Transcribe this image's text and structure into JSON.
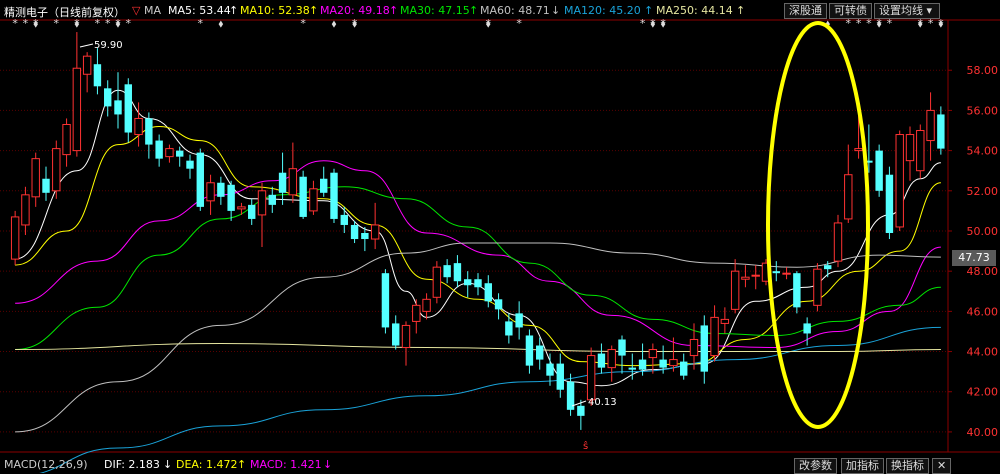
{
  "header": {
    "stock_name": "精测电子（日线前复权）",
    "ma_label": "MA",
    "ma5": "MA5: 53.44",
    "ma10": "MA10: 52.38",
    "ma20": "MA20: 49.18",
    "ma30": "MA30: 47.15",
    "ma60": "MA60: 48.71",
    "ma120": "MA120: 45.20",
    "ma250": "MA250: 44.14",
    "arrow_up": "↑",
    "arrow_down": "↓",
    "btn_shengutong": "深股通",
    "btn_kezhuanzhai": "可转债",
    "btn_setma": "设置均线"
  },
  "footer": {
    "macd_title": "MACD(12,26,9)",
    "dif": "DIF: 2.183",
    "dea": "DEA: 1.472",
    "macd": "MACD: 1.421",
    "btn_params": "改参数",
    "btn_add": "加指标",
    "btn_switch": "换指标"
  },
  "colors": {
    "up": "#ff3232",
    "down": "#54ffff",
    "ma5": "#ffffff",
    "ma10": "#ffff00",
    "ma20": "#ff00ff",
    "ma30": "#00e600",
    "ma60": "#c0c0c0",
    "ma120": "#1aa3d9",
    "ma250": "#e6e6a0",
    "ellipse": "#ffff00"
  },
  "chart_data": {
    "type": "candlestick",
    "y_ticks": [
      "58.00",
      "56.00",
      "54.00",
      "52.00",
      "50.00",
      "48.00",
      "46.00",
      "44.00",
      "42.00",
      "40.00"
    ],
    "current_price": "47.73",
    "high_annotation": "59.90",
    "low_annotation": "40.13",
    "ylim": [
      39.2,
      60.5
    ],
    "candles": [
      [
        48.6,
        50.7,
        48.3,
        51.0
      ],
      [
        50.3,
        51.8,
        49.8,
        52.2
      ],
      [
        51.7,
        53.6,
        51.2,
        53.9
      ],
      [
        52.6,
        51.9,
        51.5,
        53.2
      ],
      [
        52.0,
        54.1,
        51.6,
        54.5
      ],
      [
        53.8,
        55.3,
        53.2,
        55.6
      ],
      [
        54.0,
        58.1,
        53.7,
        59.9
      ],
      [
        57.8,
        58.7,
        56.9,
        58.9
      ],
      [
        58.3,
        57.2,
        56.8,
        59.1
      ],
      [
        57.1,
        56.2,
        55.7,
        57.5
      ],
      [
        56.5,
        55.8,
        55.1,
        57.9
      ],
      [
        57.3,
        54.9,
        54.4,
        57.6
      ],
      [
        54.8,
        55.6,
        54.2,
        56.4
      ],
      [
        55.6,
        54.3,
        53.6,
        55.9
      ],
      [
        54.5,
        53.6,
        53.2,
        54.8
      ],
      [
        53.7,
        54.1,
        53.4,
        54.3
      ],
      [
        54.0,
        53.7,
        53.2,
        54.2
      ],
      [
        53.5,
        53.1,
        52.6,
        53.8
      ],
      [
        53.9,
        51.2,
        51.0,
        54.1
      ],
      [
        51.5,
        52.4,
        50.8,
        52.8
      ],
      [
        52.4,
        51.7,
        51.3,
        52.7
      ],
      [
        52.3,
        51.0,
        50.5,
        52.5
      ],
      [
        51.1,
        51.2,
        50.8,
        51.4
      ],
      [
        51.3,
        50.6,
        50.3,
        51.6
      ],
      [
        50.8,
        52.0,
        49.2,
        52.4
      ],
      [
        51.8,
        51.3,
        50.9,
        52.2
      ],
      [
        52.9,
        51.9,
        51.3,
        53.9
      ],
      [
        51.8,
        53.1,
        51.4,
        54.4
      ],
      [
        52.7,
        50.7,
        50.6,
        53.0
      ],
      [
        51.0,
        52.1,
        50.8,
        52.5
      ],
      [
        52.6,
        51.9,
        51.7,
        53.2
      ],
      [
        52.9,
        50.6,
        50.4,
        53.1
      ],
      [
        50.8,
        50.3,
        49.9,
        51.2
      ],
      [
        50.3,
        49.6,
        49.4,
        50.5
      ],
      [
        49.9,
        49.6,
        49.0,
        50.2
      ],
      [
        49.6,
        50.3,
        49.1,
        51.4
      ],
      [
        47.9,
        45.2,
        44.9,
        48.1
      ],
      [
        45.4,
        44.3,
        44.1,
        45.8
      ],
      [
        44.2,
        45.3,
        43.3,
        45.5
      ],
      [
        45.5,
        46.3,
        44.9,
        46.6
      ],
      [
        46.0,
        46.6,
        45.6,
        46.9
      ],
      [
        46.7,
        48.2,
        46.4,
        48.5
      ],
      [
        48.3,
        47.7,
        47.4,
        48.6
      ],
      [
        48.4,
        47.5,
        47.2,
        48.8
      ],
      [
        47.6,
        47.3,
        46.7,
        48.0
      ],
      [
        47.6,
        47.2,
        46.8,
        47.9
      ],
      [
        47.4,
        46.5,
        46.2,
        47.8
      ],
      [
        46.6,
        46.1,
        45.6,
        46.9
      ],
      [
        45.5,
        44.8,
        44.4,
        45.9
      ],
      [
        45.9,
        45.2,
        44.6,
        46.5
      ],
      [
        44.8,
        43.3,
        42.9,
        45.1
      ],
      [
        44.3,
        43.6,
        43.1,
        44.7
      ],
      [
        43.4,
        42.8,
        42.3,
        43.9
      ],
      [
        43.4,
        42.1,
        41.7,
        43.9
      ],
      [
        42.5,
        41.1,
        40.8,
        42.9
      ],
      [
        41.3,
        40.8,
        40.1,
        41.6
      ],
      [
        41.6,
        43.8,
        41.3,
        44.2
      ],
      [
        43.9,
        43.2,
        42.9,
        44.4
      ],
      [
        43.2,
        44.1,
        42.5,
        44.3
      ],
      [
        44.6,
        43.8,
        42.9,
        44.8
      ],
      [
        43.2,
        43.1,
        42.6,
        43.9
      ],
      [
        43.6,
        43.1,
        42.8,
        44.4
      ],
      [
        43.7,
        44.1,
        42.9,
        44.4
      ],
      [
        43.6,
        43.2,
        42.9,
        44.3
      ],
      [
        43.3,
        43.6,
        43.0,
        44.7
      ],
      [
        43.5,
        42.8,
        42.6,
        43.9
      ],
      [
        43.8,
        44.6,
        43.1,
        45.4
      ],
      [
        45.3,
        43.0,
        42.4,
        45.8
      ],
      [
        43.8,
        45.7,
        43.5,
        46.3
      ],
      [
        45.4,
        45.6,
        44.9,
        46.2
      ],
      [
        46.1,
        48.0,
        45.9,
        48.6
      ],
      [
        47.6,
        47.7,
        47.2,
        48.3
      ],
      [
        47.8,
        47.8,
        47.1,
        48.3
      ],
      [
        47.5,
        48.4,
        47.3,
        48.6
      ],
      [
        48.0,
        47.9,
        47.5,
        48.5
      ],
      [
        47.9,
        47.9,
        47.6,
        48.2
      ],
      [
        47.9,
        46.2,
        45.9,
        48.0
      ],
      [
        45.4,
        44.9,
        44.3,
        45.7
      ],
      [
        46.3,
        48.1,
        46.0,
        48.4
      ],
      [
        48.3,
        48.1,
        47.7,
        48.5
      ],
      [
        48.5,
        50.4,
        48.2,
        50.8
      ],
      [
        50.6,
        52.8,
        50.4,
        54.3
      ],
      [
        54.0,
        54.1,
        53.6,
        56.6
      ],
      [
        53.5,
        53.4,
        52.9,
        55.3
      ],
      [
        54.0,
        52.0,
        51.7,
        54.3
      ],
      [
        52.8,
        49.9,
        49.6,
        53.2
      ],
      [
        50.2,
        54.8,
        50.0,
        55.0
      ],
      [
        53.5,
        54.8,
        52.5,
        55.2
      ],
      [
        53.0,
        55.0,
        52.6,
        55.3
      ],
      [
        54.5,
        56.0,
        53.5,
        56.9
      ],
      [
        55.8,
        54.1,
        53.8,
        56.2
      ]
    ],
    "ma_series": {
      "MA5": [
        [
          0,
          48.6
        ],
        [
          6,
          53.0
        ],
        [
          10,
          57.0
        ],
        [
          13,
          55.6
        ],
        [
          18,
          53.8
        ],
        [
          23,
          51.6
        ],
        [
          30,
          51.5
        ],
        [
          35,
          50.0
        ],
        [
          38,
          47.0
        ],
        [
          40,
          45.7
        ],
        [
          44,
          47.4
        ],
        [
          49,
          45.8
        ],
        [
          54,
          42.5
        ],
        [
          57,
          42.3
        ],
        [
          62,
          43.1
        ],
        [
          67,
          43.4
        ],
        [
          72,
          46.5
        ],
        [
          77,
          47.2
        ],
        [
          80,
          48.0
        ],
        [
          85,
          50.8
        ],
        [
          88,
          52.6
        ],
        [
          90,
          53.4
        ]
      ],
      "MA10": [
        [
          0,
          48.3
        ],
        [
          5,
          50.0
        ],
        [
          10,
          54.3
        ],
        [
          14,
          55.2
        ],
        [
          18,
          54.5
        ],
        [
          23,
          52.2
        ],
        [
          30,
          51.6
        ],
        [
          35,
          50.3
        ],
        [
          40,
          47.6
        ],
        [
          45,
          46.6
        ],
        [
          50,
          45.3
        ],
        [
          55,
          43.5
        ],
        [
          60,
          43.3
        ],
        [
          66,
          43.4
        ],
        [
          71,
          44.6
        ],
        [
          77,
          46.5
        ],
        [
          82,
          48.0
        ],
        [
          86,
          49.0
        ],
        [
          90,
          52.4
        ]
      ],
      "MA20": [
        [
          0,
          46.4
        ],
        [
          8,
          48.5
        ],
        [
          14,
          50.5
        ],
        [
          20,
          51.8
        ],
        [
          25,
          52.5
        ],
        [
          30,
          53.5
        ],
        [
          34,
          53.0
        ],
        [
          40,
          49.9
        ],
        [
          47,
          48.8
        ],
        [
          52,
          47.5
        ],
        [
          58,
          45.8
        ],
        [
          66,
          44.3
        ],
        [
          74,
          44.2
        ],
        [
          80,
          45.0
        ],
        [
          85,
          46.0
        ],
        [
          90,
          49.2
        ]
      ],
      "MA30": [
        [
          0,
          44.1
        ],
        [
          8,
          46.2
        ],
        [
          14,
          48.8
        ],
        [
          20,
          50.6
        ],
        [
          26,
          51.8
        ],
        [
          32,
          52.2
        ],
        [
          38,
          51.6
        ],
        [
          44,
          50.2
        ],
        [
          50,
          48.4
        ],
        [
          56,
          46.8
        ],
        [
          62,
          45.6
        ],
        [
          68,
          44.9
        ],
        [
          74,
          44.8
        ],
        [
          80,
          45.5
        ],
        [
          86,
          46.3
        ],
        [
          90,
          47.2
        ]
      ],
      "MA60": [
        [
          0,
          40.0
        ],
        [
          10,
          42.5
        ],
        [
          20,
          45.3
        ],
        [
          30,
          47.7
        ],
        [
          38,
          48.9
        ],
        [
          44,
          49.4
        ],
        [
          52,
          49.4
        ],
        [
          60,
          48.9
        ],
        [
          68,
          48.4
        ],
        [
          76,
          48.2
        ],
        [
          84,
          48.8
        ],
        [
          90,
          48.7
        ]
      ],
      "MA120": [
        [
          0,
          37.8
        ],
        [
          10,
          39.2
        ],
        [
          20,
          40.3
        ],
        [
          30,
          41.1
        ],
        [
          40,
          41.8
        ],
        [
          50,
          42.5
        ],
        [
          60,
          43.0
        ],
        [
          70,
          43.6
        ],
        [
          80,
          44.3
        ],
        [
          90,
          45.2
        ]
      ],
      "MA250": [
        [
          0,
          44.1
        ],
        [
          20,
          44.4
        ],
        [
          40,
          44.2
        ],
        [
          60,
          44.0
        ],
        [
          80,
          44.0
        ],
        [
          90,
          44.1
        ]
      ]
    }
  }
}
